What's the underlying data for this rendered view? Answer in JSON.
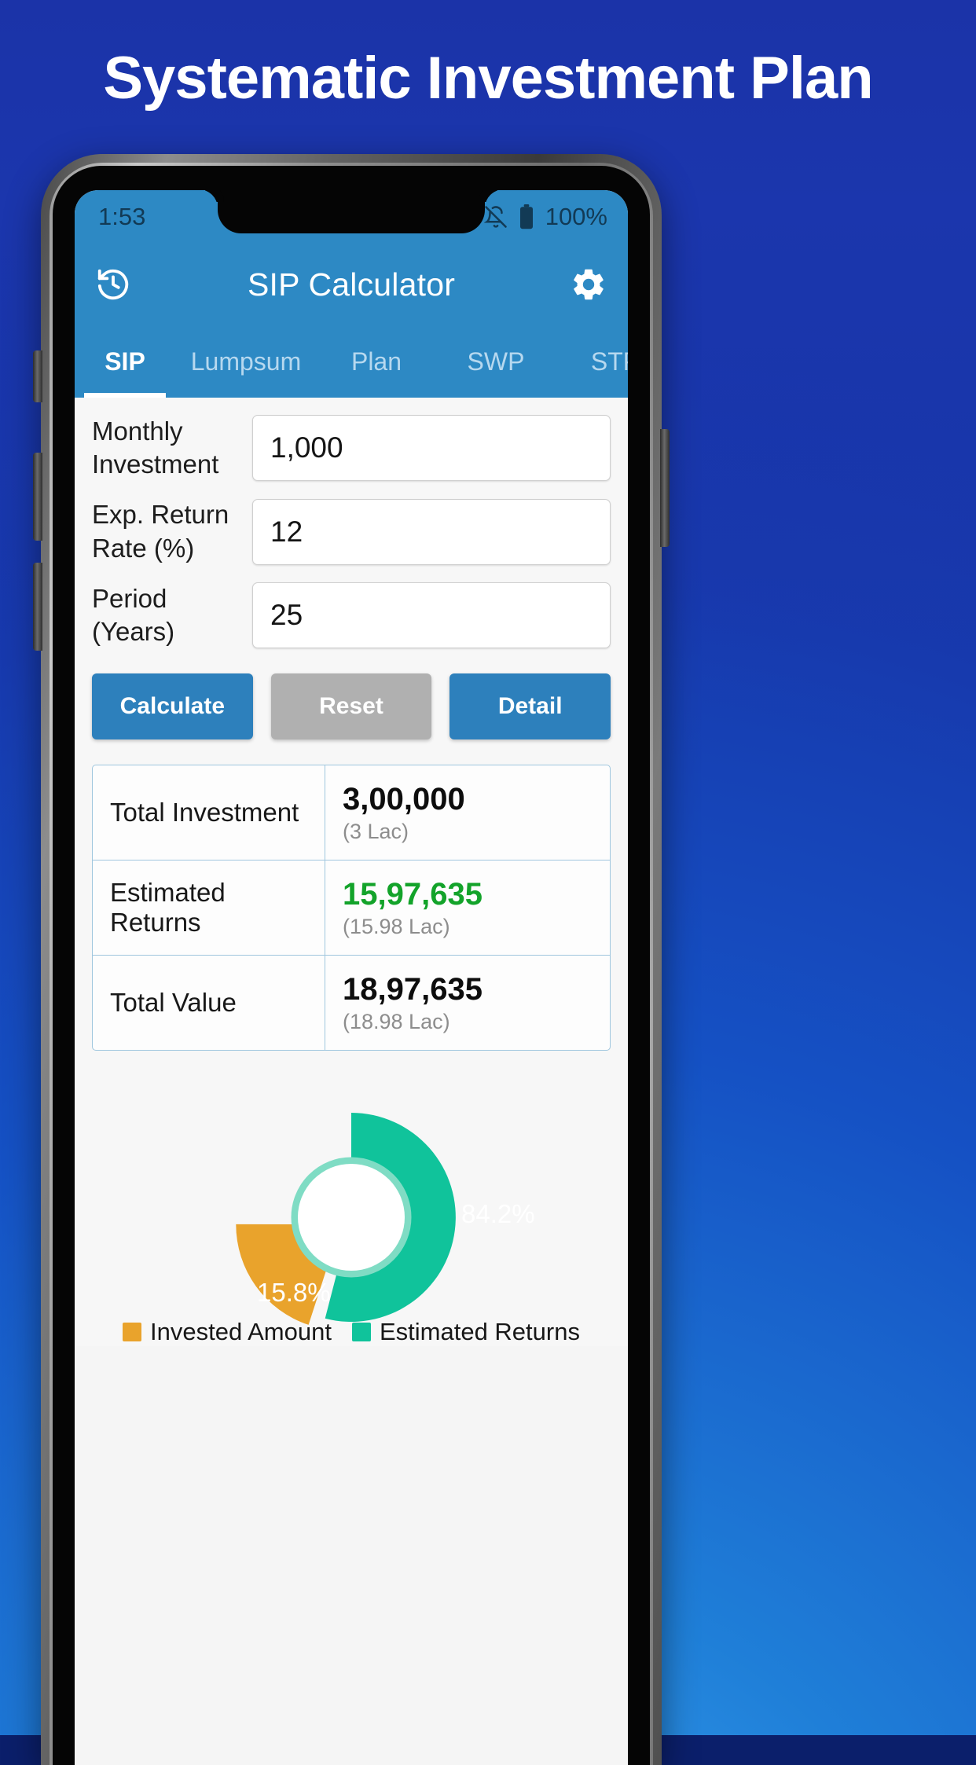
{
  "promo": {
    "title": "Systematic Investment Plan",
    "bg_top_color": "#1530a0",
    "bg_bottom_color": "#3fa9f5"
  },
  "status_bar": {
    "time": "1:53",
    "mute_icon": "bell-off-icon",
    "battery_icon": "battery-full-icon",
    "battery_text": "100%"
  },
  "appbar": {
    "history_icon": "history-icon",
    "title": "SIP Calculator",
    "settings_icon": "gear-icon",
    "background_color": "#2d89c4"
  },
  "tabs": [
    {
      "label": "SIP",
      "active": true
    },
    {
      "label": "Lumpsum",
      "active": false
    },
    {
      "label": "Plan",
      "active": false
    },
    {
      "label": "SWP",
      "active": false
    },
    {
      "label": "STP",
      "active": false
    }
  ],
  "form": {
    "fields": [
      {
        "label": "Monthly Investment",
        "value": "1,000",
        "placeholder": "Monthly Investment"
      },
      {
        "label": "Exp. Return Rate (%)",
        "value": "12",
        "placeholder": "Exp. Return Rate"
      },
      {
        "label": "Period (Years)",
        "value": "25",
        "placeholder": "Period"
      }
    ],
    "buttons": [
      {
        "label": "Calculate",
        "style": "primary"
      },
      {
        "label": "Reset",
        "style": "muted"
      },
      {
        "label": "Detail",
        "style": "primary"
      }
    ]
  },
  "results": {
    "rows": [
      {
        "label": "Total Investment",
        "amount": "3,00,000",
        "sub": "(3 Lac)",
        "color": "#0d0d0d"
      },
      {
        "label": "Estimated Returns",
        "amount": "15,97,635",
        "sub": "(15.98 Lac)",
        "color": "#13a32a"
      },
      {
        "label": "Total Value",
        "amount": "18,97,635",
        "sub": "(18.98 Lac)",
        "color": "#0d0d0d"
      }
    ]
  },
  "chart_data": {
    "type": "pie",
    "variant": "donut",
    "title": "",
    "categories": [
      "Invested Amount",
      "Estimated Returns"
    ],
    "values": [
      15.8,
      84.2
    ],
    "value_labels": [
      "15.8%",
      "84.2%"
    ],
    "colors": [
      "#e9a32c",
      "#10c39b"
    ],
    "legend_position": "bottom",
    "exploded_slice": "Invested Amount",
    "inner_radius_ratio": 0.52,
    "amounts": [
      "3,00,000",
      "15,97,635"
    ]
  },
  "chart_labels": {
    "green_percent": "84.2%",
    "orange_percent": "15.8%",
    "legend": [
      {
        "label": "Invested Amount",
        "color": "#e9a32c"
      },
      {
        "label": "Estimated Returns",
        "color": "#10c39b"
      }
    ]
  }
}
